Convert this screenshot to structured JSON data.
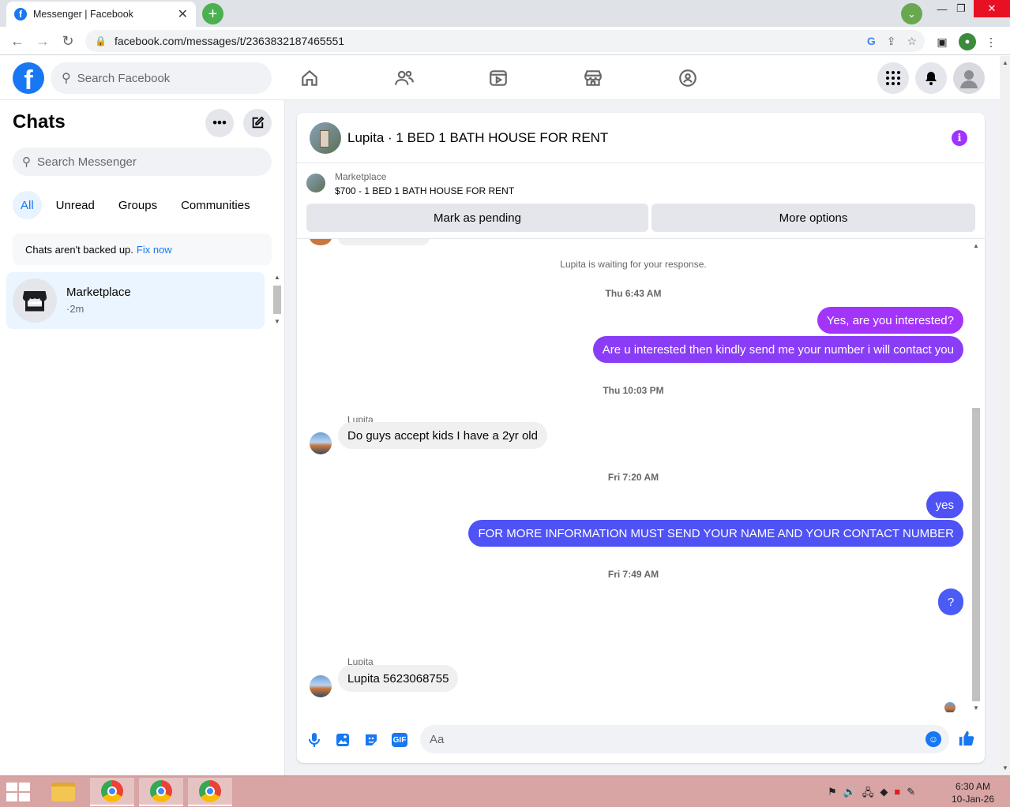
{
  "browser": {
    "tab_title": "Messenger | Facebook",
    "url": "facebook.com/messages/t/2363832187465551",
    "new_tab": "+",
    "window_minimize": "—",
    "window_restore": "❐",
    "window_close": "✕"
  },
  "fb": {
    "logo": "f",
    "search_placeholder": "Search Facebook",
    "nav_icons": [
      "home-icon",
      "friends-icon",
      "watch-icon",
      "marketplace-icon",
      "groups-icon"
    ],
    "accent": "#1877f2"
  },
  "chats": {
    "title": "Chats",
    "search_placeholder": "Search Messenger",
    "filters": [
      "All",
      "Unread",
      "Groups",
      "Communities"
    ],
    "backup_text": "Chats aren't backed up.",
    "backup_link": "Fix now",
    "items": [
      {
        "name": "Marketplace",
        "time": "·2m"
      }
    ]
  },
  "conversation": {
    "title": "Lupita · 1 BED 1 BATH HOUSE FOR RENT",
    "marketplace_label": "Marketplace",
    "listing": "$700 - 1 BED 1 BATH HOUSE FOR RENT",
    "mark_pending": "Mark as pending",
    "more_options": "More options",
    "system_note": "Lupita is waiting for your response.",
    "timestamps": [
      "Thu 6:43 AM",
      "Thu 10:03 PM",
      "Fri 7:20 AM",
      "Fri 7:49 AM"
    ],
    "messages": [
      {
        "from": "me",
        "text": "Yes, are you interested?"
      },
      {
        "from": "me",
        "text": "Are u interested then kindly send me your number i will contact you"
      },
      {
        "from": "Lupita",
        "text": "Do guys accept kids I have a 2yr old"
      },
      {
        "from": "me",
        "text": "yes"
      },
      {
        "from": "me",
        "text": "FOR MORE INFORMATION MUST SEND YOUR NAME AND YOUR CONTACT NUMBER"
      },
      {
        "from": "me",
        "text": "?"
      },
      {
        "from": "Lupita",
        "text": "Lupita 5623068755"
      }
    ],
    "sender_name": "Lupita",
    "composer_placeholder": "Aa",
    "gif_label": "GIF",
    "bubble_colors": [
      "#a334fa",
      "#8a3df7",
      "#4f52f5",
      "#4a5cf5"
    ]
  },
  "taskbar": {
    "time": "6:30 AM",
    "date": "10-Jan-26"
  }
}
